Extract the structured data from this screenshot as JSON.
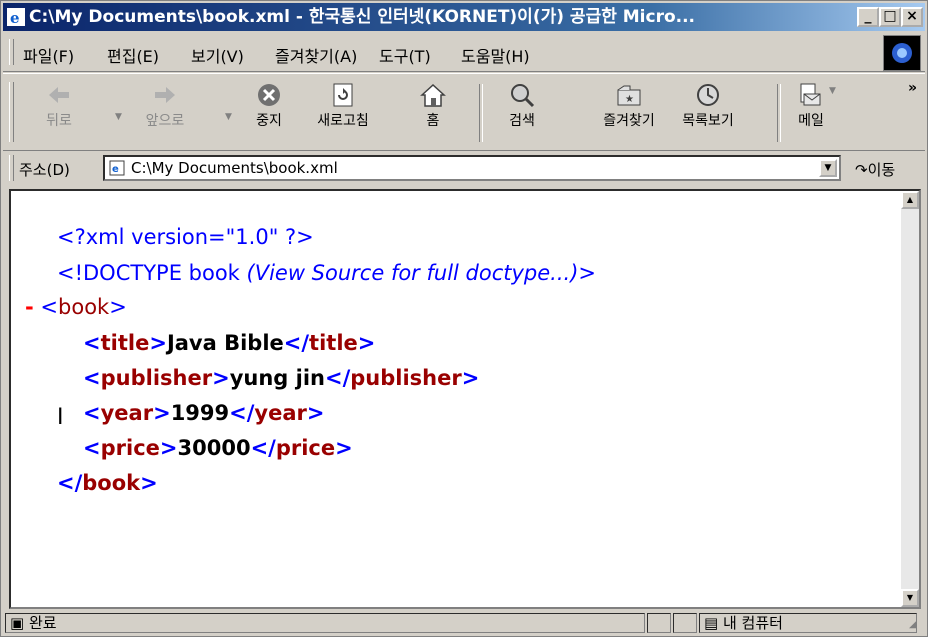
{
  "window": {
    "title": "C:\\My Documents\\book.xml - 한국통신 인터넷(KORNET)이(가) 공급한 Micro...",
    "controls": [
      "_",
      "□",
      "×"
    ]
  },
  "menubar": {
    "items": [
      "파일(F)",
      "편집(E)",
      "보기(V)",
      "즐겨찾기(A)",
      "도구(T)",
      "도움말(H)"
    ]
  },
  "toolbar": {
    "back": "뒤로",
    "forward": "앞으로",
    "stop": "중지",
    "refresh": "새로고침",
    "home": "홈",
    "search": "검색",
    "favorites": "즐겨찾기",
    "history": "목록보기",
    "mail": "메일",
    "more": "»"
  },
  "address": {
    "label": "주소(D)",
    "value": "C:\\My Documents\\book.xml",
    "go_label": "이동"
  },
  "document": {
    "xml_decl": "<?xml version=\"1.0\" ?>",
    "doctype_open": "<!DOCTYPE book ",
    "doctype_note": "(View Source for full doctype...)",
    "doctype_close": ">",
    "collapse_marker": "-",
    "root_tag": "book",
    "children": [
      {
        "tag": "title",
        "value": "Java Bible"
      },
      {
        "tag": "publisher",
        "value": "yung jin"
      },
      {
        "tag": "year",
        "value": "1999"
      },
      {
        "tag": "price",
        "value": "30000"
      }
    ]
  },
  "statusbar": {
    "status": "완료",
    "zone": "내 컴퓨터"
  }
}
